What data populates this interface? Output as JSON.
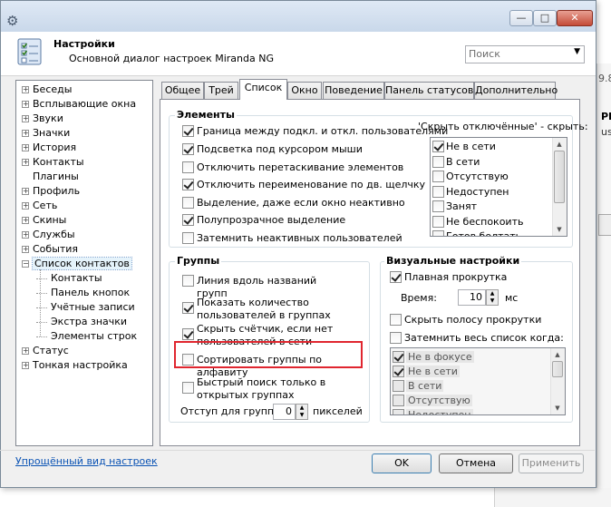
{
  "header": {
    "title": "Настройки",
    "subtitle": "Основной диалог настроек Miranda NG",
    "search_placeholder": "Поиск"
  },
  "window_controls": {
    "minimize": "—",
    "maximize": "□",
    "close": "✕"
  },
  "tree": {
    "items": [
      {
        "label": "Беседы",
        "expandable": true
      },
      {
        "label": "Всплывающие окна",
        "expandable": true
      },
      {
        "label": "Звуки",
        "expandable": true
      },
      {
        "label": "Значки",
        "expandable": true
      },
      {
        "label": "История",
        "expandable": true
      },
      {
        "label": "Контакты",
        "expandable": true
      },
      {
        "label": "Плагины",
        "expandable": false
      },
      {
        "label": "Профиль",
        "expandable": true
      },
      {
        "label": "Сеть",
        "expandable": true
      },
      {
        "label": "Скины",
        "expandable": true
      },
      {
        "label": "Службы",
        "expandable": true
      },
      {
        "label": "События",
        "expandable": true
      },
      {
        "label": "Список контактов",
        "expandable": true,
        "expanded": true,
        "selected": true
      },
      {
        "label": "Контакты",
        "child": true
      },
      {
        "label": "Панель кнопок",
        "child": true
      },
      {
        "label": "Учётные записи",
        "child": true
      },
      {
        "label": "Экстра значки",
        "child": true
      },
      {
        "label": "Элементы строк",
        "child": true
      },
      {
        "label": "Статус",
        "expandable": true
      },
      {
        "label": "Тонкая настройка",
        "expandable": true
      }
    ]
  },
  "tabs": [
    "Общее",
    "Трей",
    "Список",
    "Окно",
    "Поведение",
    "Панель статусов",
    "Дополнительно"
  ],
  "active_tab": "Список",
  "elements_group": {
    "title": "Элементы",
    "options": [
      {
        "label": "Граница между подкл. и откл. пользователями",
        "checked": true
      },
      {
        "label": "Подсветка под курсором мыши",
        "checked": true
      },
      {
        "label": "Отключить перетаскивание элементов",
        "checked": false
      },
      {
        "label": "Отключить переименование по дв. щелчку",
        "checked": true
      },
      {
        "label": "Выделение, даже если окно неактивно",
        "checked": false
      },
      {
        "label": "Полупрозрачное выделение",
        "checked": true
      },
      {
        "label": "Затемнить неактивных пользователей",
        "checked": false
      }
    ],
    "hide_offline_label": "'Скрыть отключённые' - скрыть:",
    "hide_offline_list": [
      {
        "label": "Не в сети",
        "checked": true
      },
      {
        "label": "В сети",
        "checked": false
      },
      {
        "label": "Отсутствую",
        "checked": false
      },
      {
        "label": "Недоступен",
        "checked": false
      },
      {
        "label": "Занят",
        "checked": false
      },
      {
        "label": "Не беспокоить",
        "checked": false
      },
      {
        "label": "Готов болтать",
        "checked": false
      }
    ]
  },
  "groups_group": {
    "title": "Группы",
    "options": [
      {
        "label": "Линия вдоль названий групп",
        "checked": false
      },
      {
        "label": "Показать количество пользователей в группах",
        "checked": true
      },
      {
        "label": "Скрыть счётчик, если нет пользователей в сети",
        "checked": true
      },
      {
        "label": "Сортировать группы по алфавиту",
        "checked": false
      },
      {
        "label": "Быстрый поиск только в открытых группах",
        "checked": false
      }
    ],
    "indent_label": "Отступ для групп:",
    "indent_value": "0",
    "indent_unit": "пикселей"
  },
  "visual_group": {
    "title": "Визуальные настройки",
    "smooth_scroll": {
      "label": "Плавная прокрутка",
      "checked": true
    },
    "time_label": "Время:",
    "time_value": "10",
    "time_unit": "мс",
    "hide_scrollbar": {
      "label": "Скрыть полосу прокрутки",
      "checked": false
    },
    "dim_list": {
      "label": "Затемнить весь список когда:",
      "checked": false
    },
    "dim_list_items": [
      {
        "label": "Не в фокусе",
        "checked": true
      },
      {
        "label": "Не в сети",
        "checked": true
      },
      {
        "label": "В сети",
        "checked": false
      },
      {
        "label": "Отсутствую",
        "checked": false
      },
      {
        "label": "Недоступен",
        "checked": false
      }
    ]
  },
  "footer": {
    "simple_view_link": "Упрощённый вид настроек",
    "ok": "OK",
    "cancel": "Отмена",
    "apply": "Применить"
  },
  "background_fragments": {
    "a": "9.8",
    "b": "PI",
    "c": "us"
  }
}
